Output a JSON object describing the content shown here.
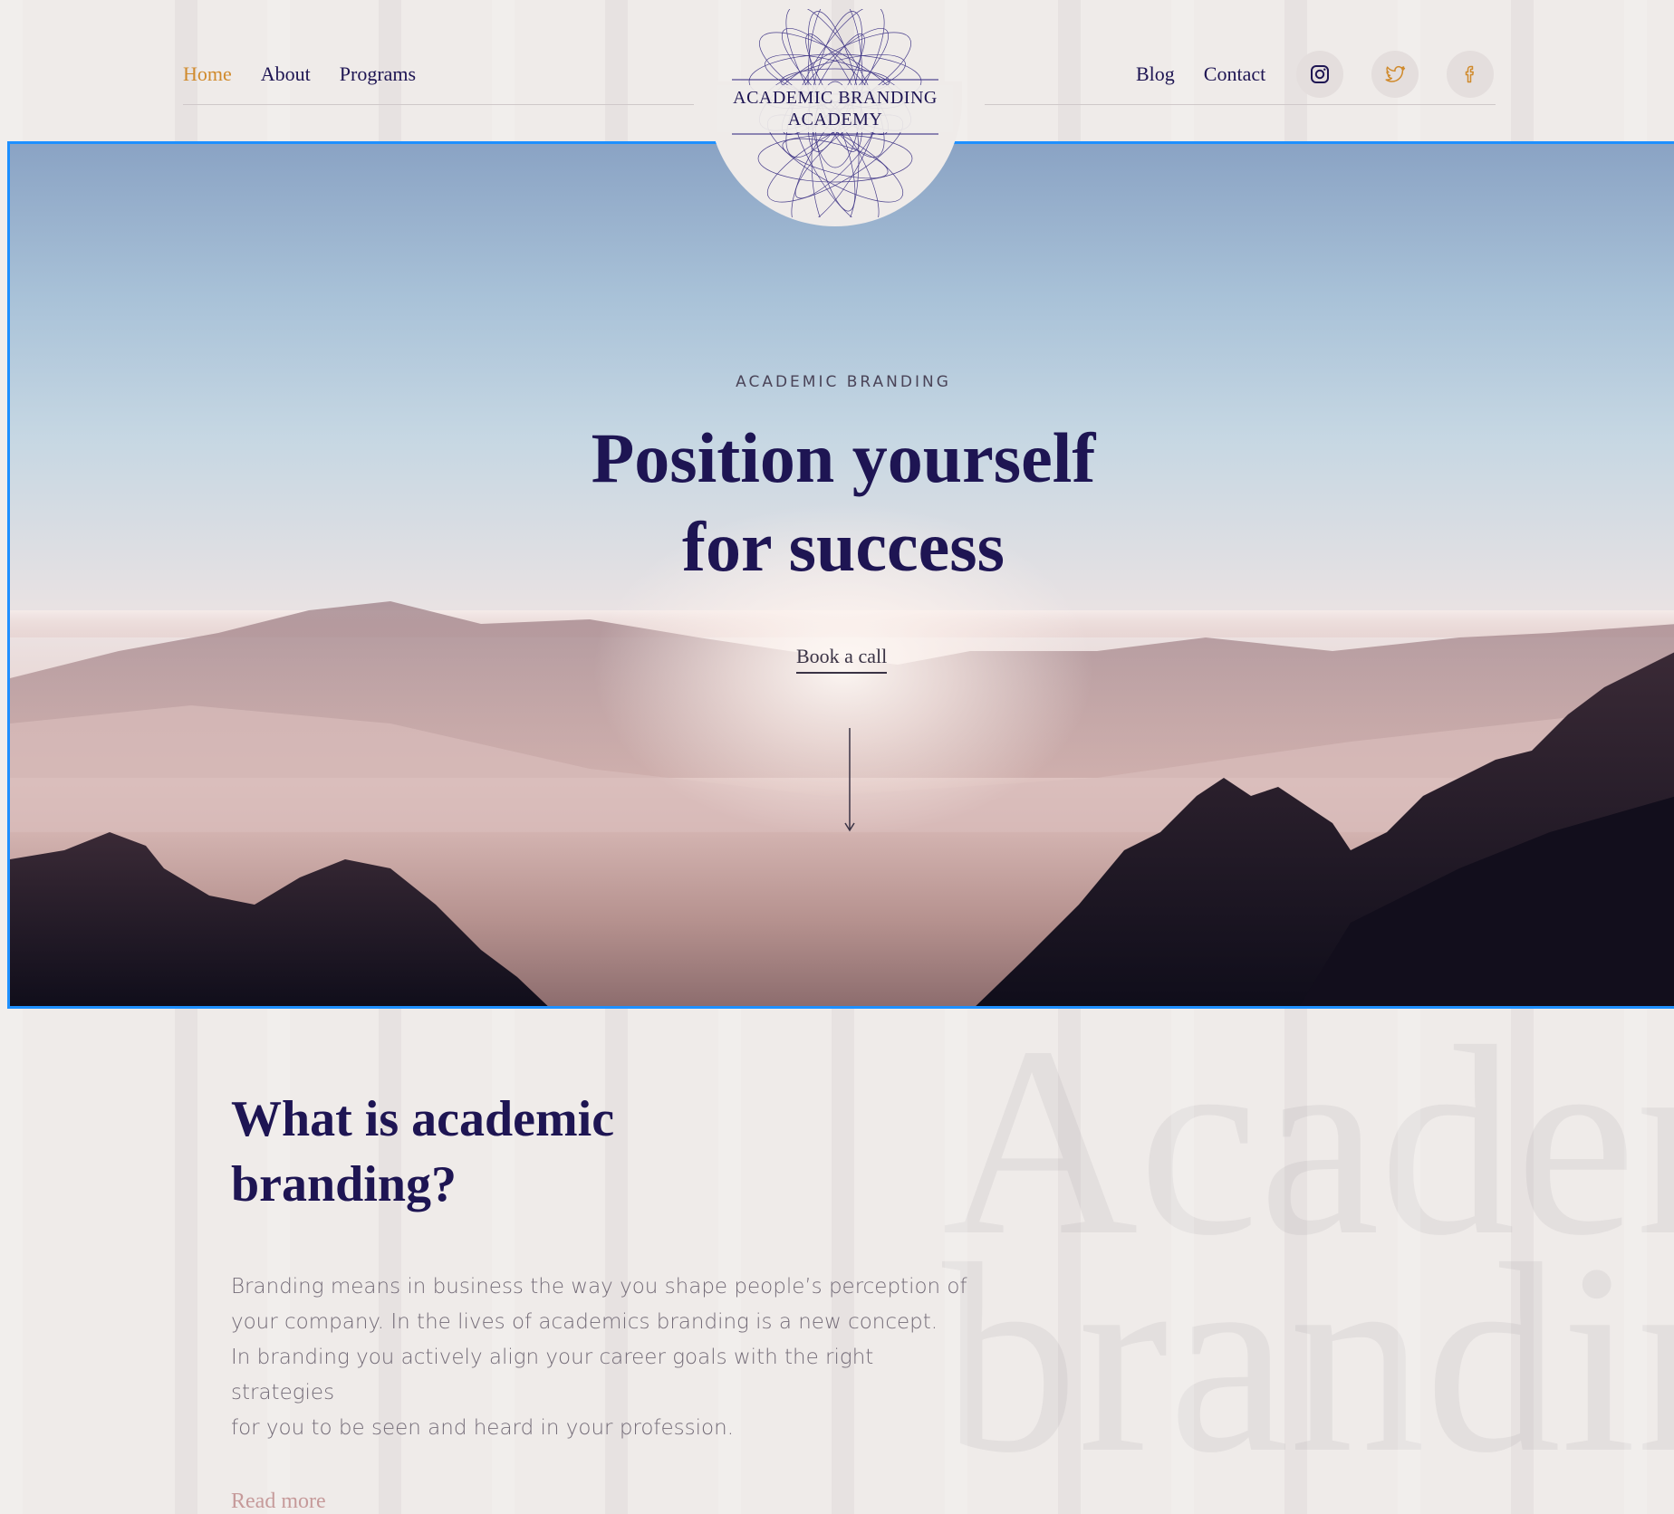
{
  "nav": {
    "left": [
      {
        "label": "Home",
        "active": true
      },
      {
        "label": "About",
        "active": false
      },
      {
        "label": "Programs",
        "active": false
      }
    ],
    "right": [
      {
        "label": "Blog"
      },
      {
        "label": "Contact"
      }
    ],
    "social": [
      "instagram-icon",
      "twitter-icon",
      "facebook-icon"
    ]
  },
  "logo": {
    "line1": "ACADEMIC BRANDING",
    "line2": "ACADEMY"
  },
  "hero": {
    "eyebrow": "ACADEMIC BRANDING",
    "title_line1": "Position yourself",
    "title_line2": "for success",
    "cta": "Book a call"
  },
  "section": {
    "title": "What is academic branding?",
    "body_line1": "Branding means in business the way you shape people’s perception of",
    "body_line2": "your company. In the lives of academics branding is a new concept.",
    "body_line3": "In branding you actively align your career goals with the right strategies",
    "body_line4": "for you to be seen and heard in your profession.",
    "read_more": "Read more",
    "watermark": "Academic\nbranding"
  },
  "colors": {
    "brand": "#1e1553",
    "accent": "#d08a2c",
    "rose": "#c69a9a",
    "background": "#efebe9"
  }
}
